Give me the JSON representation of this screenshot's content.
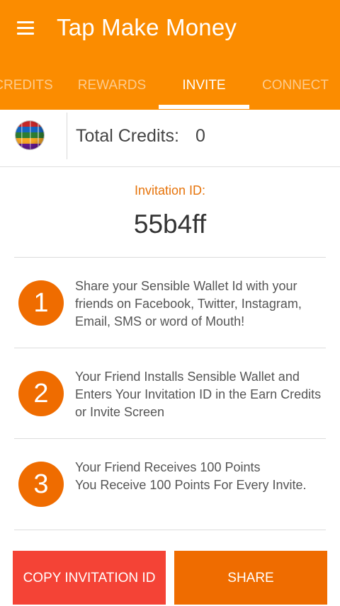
{
  "app": {
    "title": "Tap Make Money"
  },
  "tabs": [
    {
      "label": "CREDITS"
    },
    {
      "label": "REWARDS"
    },
    {
      "label": "INVITE",
      "active": true
    },
    {
      "label": "CONNECT"
    }
  ],
  "credits": {
    "label": "Total Credits:",
    "value": "0"
  },
  "invitation": {
    "label": "Invitation ID:",
    "id": "55b4ff"
  },
  "steps": [
    {
      "number": "1",
      "text": "Share your Sensible Wallet Id with your friends on Facebook, Twitter, Instagram, Email, SMS or word of Mouth!"
    },
    {
      "number": "2",
      "text": "Your Friend Installs Sensible Wallet and Enters Your Invitation ID in the Earn Credits or Invite Screen"
    },
    {
      "number": "3",
      "text": "Your Friend Receives 100 Points\n You Receive 100 Points For Every Invite."
    }
  ],
  "buttons": {
    "copy": "COPY INVITATION ID",
    "share": "SHARE"
  },
  "icons": {
    "menu": "hamburger-menu-icon",
    "globe": "globe-flags-icon"
  },
  "colors": {
    "primary": "#fb8c00",
    "accent": "#ef6c00",
    "copy_button": "#f44336",
    "invite_label": "#e6730a"
  }
}
